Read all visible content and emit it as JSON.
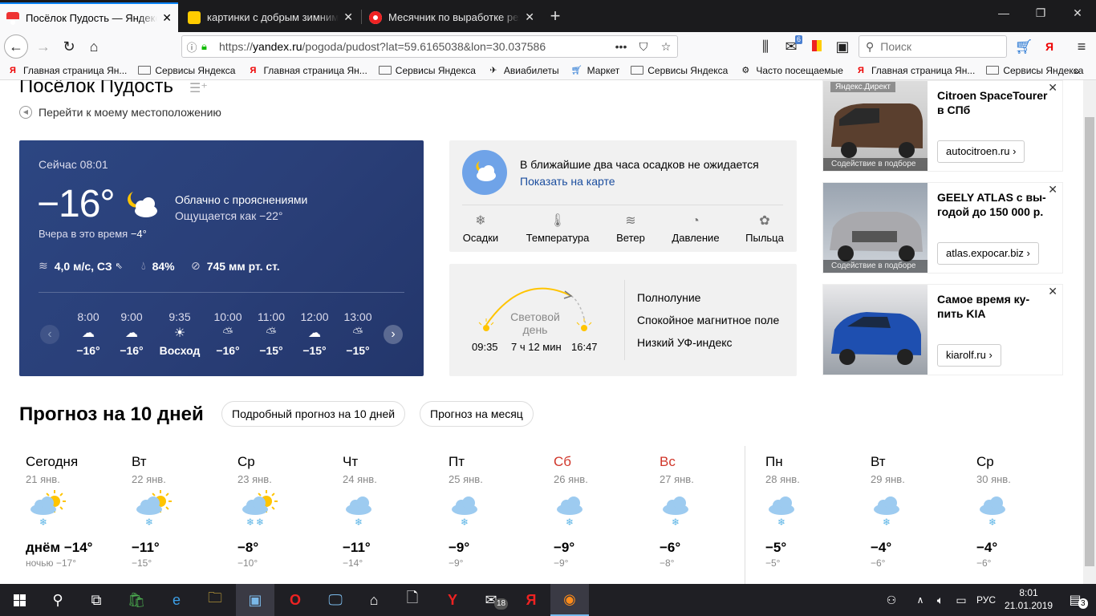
{
  "browser": {
    "tabs": [
      {
        "title": "Посёлок Пудость — Яндекс.Погода",
        "active": true
      },
      {
        "title": "картинки с добрым зимним утром",
        "active": false
      },
      {
        "title": "Месячник по выработке режима",
        "active": false
      }
    ],
    "new_tab": "+",
    "url_prefix": "https://",
    "url_domain": "yandex.ru",
    "url_rest": "/pogoda/pudost?lat=59.6165038&lon=30.037586",
    "search_placeholder": "Поиск",
    "notification_count": "6",
    "ya_letter": "Я",
    "bookmarks": [
      {
        "label": "Главная страница Ян...",
        "icon": "yandex-icon"
      },
      {
        "label": "Сервисы Яндекса",
        "icon": "folder-icon"
      },
      {
        "label": "Главная страница Ян...",
        "icon": "yandex-icon"
      },
      {
        "label": "Сервисы Яндекса",
        "icon": "folder-icon"
      },
      {
        "label": "Авиабилеты",
        "icon": "plane-icon"
      },
      {
        "label": "Маркет",
        "icon": "cart-icon"
      },
      {
        "label": "Сервисы Яндекса",
        "icon": "folder-icon"
      },
      {
        "label": "Часто посещаемые",
        "icon": "gear-icon"
      },
      {
        "label": "Главная страница Ян...",
        "icon": "yandex-icon"
      },
      {
        "label": "Сервисы Яндекса",
        "icon": "folder-icon"
      }
    ]
  },
  "page": {
    "city": "Посёлок Пудость",
    "my_location": "Перейти к моему местоположению",
    "now": {
      "label": "Сейчас 08:01",
      "temp": "−16°",
      "condition": "Облачно с прояснениями",
      "feels_like": "Ощущается как −22°",
      "yesterday_label": "Вчера в это время",
      "yesterday_value": "−4°",
      "wind": "4,0 м/с, СЗ",
      "humidity": "84%",
      "pressure": "745 мм рт. ст.",
      "hours": [
        {
          "time": "8:00",
          "value": "−16°"
        },
        {
          "time": "9:00",
          "value": "−16°"
        },
        {
          "time": "9:35",
          "value": "Восход"
        },
        {
          "time": "10:00",
          "value": "−16°"
        },
        {
          "time": "11:00",
          "value": "−15°"
        },
        {
          "time": "12:00",
          "value": "−15°"
        },
        {
          "time": "13:00",
          "value": "−15°"
        }
      ]
    },
    "precip": {
      "text": "В ближайшие два часа осадков не ожидается",
      "link": "Показать на карте",
      "tabs": [
        "Осадки",
        "Температура",
        "Ветер",
        "Давление",
        "Пыльца"
      ]
    },
    "sun": {
      "label_line1": "Световой",
      "label_line2": "день",
      "sunrise": "09:35",
      "length": "7 ч 12 мин",
      "sunset": "16:47",
      "info": [
        "Полнолуние",
        "Спокойное магнитное поле",
        "Низкий УФ-индекс"
      ]
    },
    "ads": {
      "direct_label": "Яндекс.Директ",
      "items": [
        {
          "title": "Citroen SpaceTourer в СПб",
          "button": "autocitroen.ru",
          "caption": "Содействие в подборе"
        },
        {
          "title": "GEELY ATLAS с вы­годой до 150 000 р.",
          "button": "atlas.expocar.biz",
          "caption": "Содействие в подборе"
        },
        {
          "title": "Самое время ку­пить KIA",
          "button": "kiarolf.ru",
          "caption": ""
        }
      ]
    },
    "forecast": {
      "title": "Прогноз на 10 дней",
      "btn_10": "Подробный прогноз на 10 дней",
      "btn_month": "Прогноз на месяц",
      "days": [
        {
          "name": "Сегодня",
          "date": "21 янв.",
          "temp": "днём −14°",
          "night": "ночью −17°",
          "weekend": false,
          "icon": "sun-cloud-snow"
        },
        {
          "name": "Вт",
          "date": "22 янв.",
          "temp": "−11°",
          "night": "−15°",
          "weekend": false,
          "icon": "sun-cloud-snow"
        },
        {
          "name": "Ср",
          "date": "23 янв.",
          "temp": "−8°",
          "night": "−10°",
          "weekend": false,
          "icon": "sun-cloud-snow2"
        },
        {
          "name": "Чт",
          "date": "24 янв.",
          "temp": "−11°",
          "night": "−14°",
          "weekend": false,
          "icon": "cloud-snow"
        },
        {
          "name": "Пт",
          "date": "25 янв.",
          "temp": "−9°",
          "night": "−9°",
          "weekend": false,
          "icon": "cloud-snow"
        },
        {
          "name": "Сб",
          "date": "26 янв.",
          "temp": "−9°",
          "night": "−9°",
          "weekend": true,
          "icon": "cloud-snow"
        },
        {
          "name": "Вс",
          "date": "27 янв.",
          "temp": "−6°",
          "night": "−8°",
          "weekend": true,
          "icon": "cloud-snow"
        },
        {
          "name": "Пн",
          "date": "28 янв.",
          "temp": "−5°",
          "night": "−5°",
          "weekend": false,
          "icon": "cloud-snow"
        },
        {
          "name": "Вт",
          "date": "29 янв.",
          "temp": "−4°",
          "night": "−6°",
          "weekend": false,
          "icon": "cloud-snow"
        },
        {
          "name": "Ср",
          "date": "30 янв.",
          "temp": "−4°",
          "night": "−6°",
          "weekend": false,
          "icon": "cloud-snow"
        }
      ]
    }
  },
  "taskbar": {
    "time": "8:01",
    "date": "21.01.2019",
    "lang": "РУС",
    "mail_badge": "18",
    "notif_badge": "3"
  },
  "colors": {
    "now_card": "#2a3f78",
    "link": "#1a4d9e",
    "weekend": "#d0362a",
    "snow": "#5bb4e6",
    "cloud": "#9dcbf0",
    "sun": "#ffc400"
  }
}
